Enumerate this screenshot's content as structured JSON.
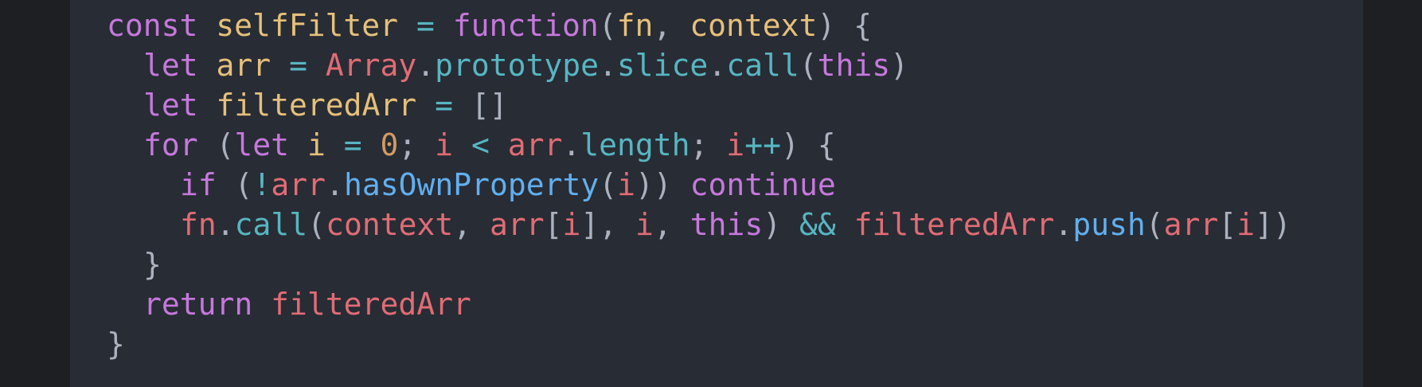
{
  "code": {
    "language": "javascript",
    "theme": "dark",
    "lines": [
      {
        "indent": 0,
        "tokens": [
          {
            "t": "const",
            "k": "kw"
          },
          {
            "t": " ",
            "k": "plain"
          },
          {
            "t": "selfFilter",
            "k": "decl"
          },
          {
            "t": " ",
            "k": "plain"
          },
          {
            "t": "=",
            "k": "op"
          },
          {
            "t": " ",
            "k": "plain"
          },
          {
            "t": "function",
            "k": "kw"
          },
          {
            "t": "(",
            "k": "punc"
          },
          {
            "t": "fn",
            "k": "decl"
          },
          {
            "t": ", ",
            "k": "punc"
          },
          {
            "t": "context",
            "k": "decl"
          },
          {
            "t": ") {",
            "k": "punc"
          }
        ]
      },
      {
        "indent": 1,
        "tokens": [
          {
            "t": "let",
            "k": "kw"
          },
          {
            "t": " ",
            "k": "plain"
          },
          {
            "t": "arr",
            "k": "decl"
          },
          {
            "t": " ",
            "k": "plain"
          },
          {
            "t": "=",
            "k": "op"
          },
          {
            "t": " ",
            "k": "plain"
          },
          {
            "t": "Array",
            "k": "var"
          },
          {
            "t": ".",
            "k": "punc"
          },
          {
            "t": "prototype",
            "k": "builtin"
          },
          {
            "t": ".",
            "k": "punc"
          },
          {
            "t": "slice",
            "k": "builtin"
          },
          {
            "t": ".",
            "k": "punc"
          },
          {
            "t": "call",
            "k": "builtin"
          },
          {
            "t": "(",
            "k": "punc"
          },
          {
            "t": "this",
            "k": "kw"
          },
          {
            "t": ")",
            "k": "punc"
          }
        ]
      },
      {
        "indent": 1,
        "tokens": [
          {
            "t": "let",
            "k": "kw"
          },
          {
            "t": " ",
            "k": "plain"
          },
          {
            "t": "filteredArr",
            "k": "decl"
          },
          {
            "t": " ",
            "k": "plain"
          },
          {
            "t": "=",
            "k": "op"
          },
          {
            "t": " ",
            "k": "plain"
          },
          {
            "t": "[]",
            "k": "punc"
          }
        ]
      },
      {
        "indent": 1,
        "tokens": [
          {
            "t": "for",
            "k": "kw"
          },
          {
            "t": " (",
            "k": "punc"
          },
          {
            "t": "let",
            "k": "kw"
          },
          {
            "t": " ",
            "k": "plain"
          },
          {
            "t": "i",
            "k": "decl"
          },
          {
            "t": " ",
            "k": "plain"
          },
          {
            "t": "=",
            "k": "op"
          },
          {
            "t": " ",
            "k": "plain"
          },
          {
            "t": "0",
            "k": "num"
          },
          {
            "t": "; ",
            "k": "punc"
          },
          {
            "t": "i",
            "k": "var"
          },
          {
            "t": " ",
            "k": "plain"
          },
          {
            "t": "<",
            "k": "op"
          },
          {
            "t": " ",
            "k": "plain"
          },
          {
            "t": "arr",
            "k": "var"
          },
          {
            "t": ".",
            "k": "punc"
          },
          {
            "t": "length",
            "k": "builtin"
          },
          {
            "t": "; ",
            "k": "punc"
          },
          {
            "t": "i",
            "k": "var"
          },
          {
            "t": "++",
            "k": "op"
          },
          {
            "t": ") {",
            "k": "punc"
          }
        ]
      },
      {
        "indent": 2,
        "tokens": [
          {
            "t": "if",
            "k": "kw"
          },
          {
            "t": " (",
            "k": "punc"
          },
          {
            "t": "!",
            "k": "op"
          },
          {
            "t": "arr",
            "k": "var"
          },
          {
            "t": ".",
            "k": "punc"
          },
          {
            "t": "hasOwnProperty",
            "k": "fn"
          },
          {
            "t": "(",
            "k": "punc"
          },
          {
            "t": "i",
            "k": "var"
          },
          {
            "t": ")) ",
            "k": "punc"
          },
          {
            "t": "continue",
            "k": "kw"
          }
        ]
      },
      {
        "indent": 2,
        "tokens": [
          {
            "t": "fn",
            "k": "var"
          },
          {
            "t": ".",
            "k": "punc"
          },
          {
            "t": "call",
            "k": "builtin"
          },
          {
            "t": "(",
            "k": "punc"
          },
          {
            "t": "context",
            "k": "var"
          },
          {
            "t": ", ",
            "k": "punc"
          },
          {
            "t": "arr",
            "k": "var"
          },
          {
            "t": "[",
            "k": "punc"
          },
          {
            "t": "i",
            "k": "var"
          },
          {
            "t": "], ",
            "k": "punc"
          },
          {
            "t": "i",
            "k": "var"
          },
          {
            "t": ", ",
            "k": "punc"
          },
          {
            "t": "this",
            "k": "kw"
          },
          {
            "t": ") ",
            "k": "punc"
          },
          {
            "t": "&&",
            "k": "op"
          },
          {
            "t": " ",
            "k": "plain"
          },
          {
            "t": "filteredArr",
            "k": "var"
          },
          {
            "t": ".",
            "k": "punc"
          },
          {
            "t": "push",
            "k": "fn"
          },
          {
            "t": "(",
            "k": "punc"
          },
          {
            "t": "arr",
            "k": "var"
          },
          {
            "t": "[",
            "k": "punc"
          },
          {
            "t": "i",
            "k": "var"
          },
          {
            "t": "])",
            "k": "punc"
          }
        ]
      },
      {
        "indent": 1,
        "tokens": [
          {
            "t": "}",
            "k": "punc"
          }
        ]
      },
      {
        "indent": 1,
        "tokens": [
          {
            "t": "return",
            "k": "kw"
          },
          {
            "t": " ",
            "k": "plain"
          },
          {
            "t": "filteredArr",
            "k": "var"
          }
        ]
      },
      {
        "indent": 0,
        "tokens": [
          {
            "t": "}",
            "k": "punc"
          }
        ]
      }
    ]
  }
}
